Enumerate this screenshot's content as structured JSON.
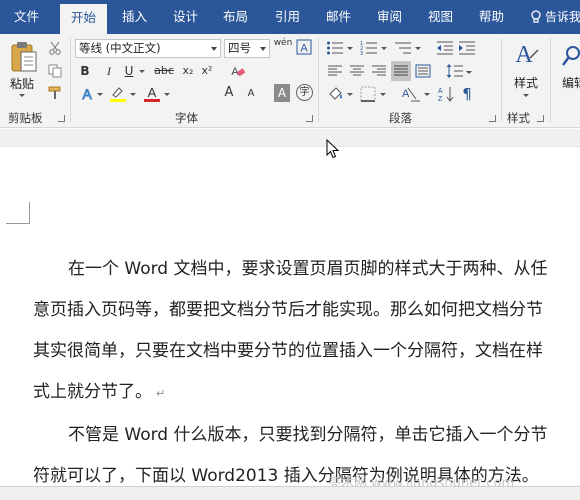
{
  "tabs": [
    {
      "label": "文件"
    },
    {
      "label": "开始"
    },
    {
      "label": "插入"
    },
    {
      "label": "设计"
    },
    {
      "label": "布局"
    },
    {
      "label": "引用"
    },
    {
      "label": "邮件"
    },
    {
      "label": "审阅"
    },
    {
      "label": "视图"
    },
    {
      "label": "帮助"
    }
  ],
  "tell_me": "告诉我",
  "ribbon": {
    "clipboard": {
      "paste_label": "粘贴",
      "group_label": "剪贴板"
    },
    "font": {
      "font_name": "等线 (中文正文)",
      "font_size": "四号",
      "phonetic_glyph": "wén",
      "bold": "B",
      "italic": "I",
      "underline": "U",
      "strike": "abc",
      "subscript": "x₂",
      "superscript": "x²",
      "highlight_color": "#ffff00",
      "font_color": "#d9262d",
      "grow": "A",
      "shrink": "A",
      "char_shading": "A",
      "enclose": "字",
      "group_label": "字体"
    },
    "paragraph": {
      "group_label": "段落"
    },
    "styles": {
      "label": "样式",
      "group_label": "样式"
    },
    "editing": {
      "label": "编辑"
    }
  },
  "document": {
    "lines": [
      "在一个 Word 文档中，要求设置页眉页脚的样式大于两种、从任",
      "意页插入页码等，都要把文档分节后才能实现。那么如何把文档分节",
      "其实很简单，只要在文档中要分节的位置插入一个分隔符，文档在样",
      "式上就分节了。",
      "不管是 Word 什么版本，只要找到分隔符，单击它插入一个分节",
      "符就可以了，下面以 Word2013 插入分隔符为例说明具体的方法。"
    ],
    "pilcrow": "↵"
  },
  "watermark": "亮术网 www.liangshunet.com",
  "colors": {
    "tab_bar": "#2b579a",
    "ribbon_bg": "#f3f3f3"
  }
}
